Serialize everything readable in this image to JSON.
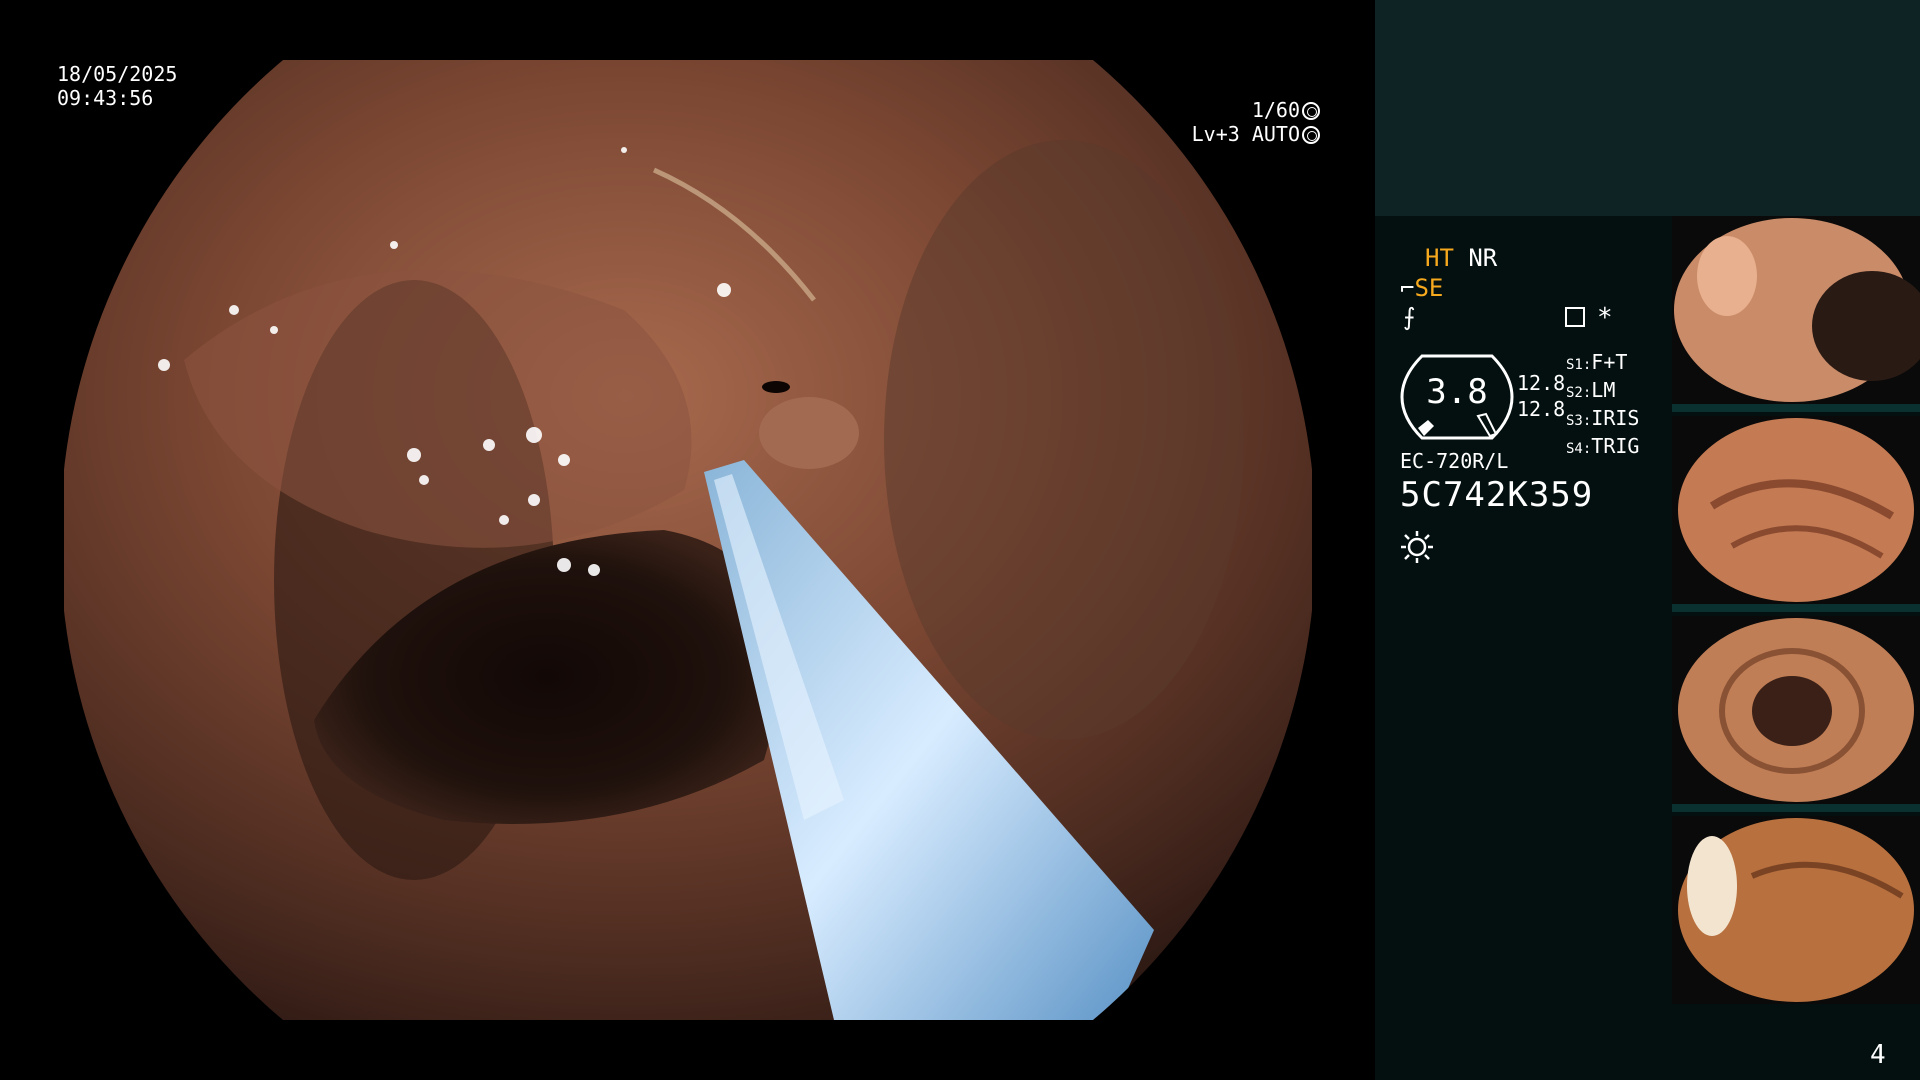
{
  "overlay": {
    "date": "18/05/2025",
    "time": "09:43:56",
    "shutter": "1/60",
    "iris": "Lv+3 AUTO"
  },
  "panel": {
    "mode_ht": "HT",
    "mode_nr": "NR",
    "mode_se": "SE",
    "sharp_symbol": "⨍",
    "gauge_value": "3.8",
    "readout_1": "12.8",
    "readout_2": "12.8",
    "star": "*",
    "switches": [
      {
        "label": "S1:",
        "value": "F+T"
      },
      {
        "label": "S2:",
        "value": "LM"
      },
      {
        "label": "S3:",
        "value": "IRIS"
      },
      {
        "label": "S4:",
        "value": "TRIG"
      }
    ],
    "scope_model": "EC-720R/L",
    "serial": "5C742K359",
    "page_number": "4"
  },
  "colors": {
    "accent": "#f7a91e",
    "panel_top": "#0e2424",
    "panel_bg": "#041010"
  },
  "icons": {
    "shutter": "shutter-icon",
    "iris": "iris-icon",
    "light": "light-source-icon",
    "record": "record-icon"
  }
}
